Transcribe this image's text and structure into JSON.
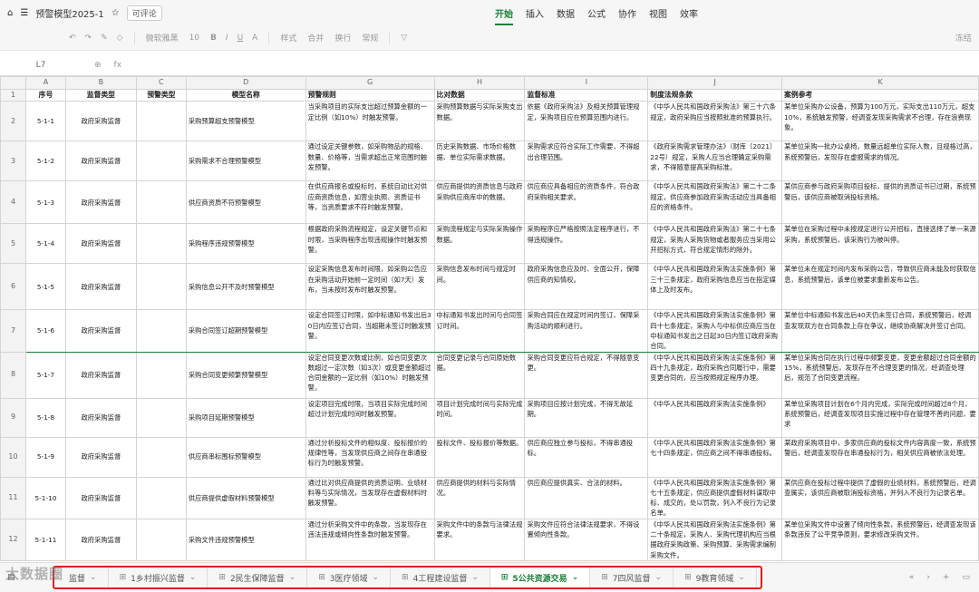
{
  "app": {
    "title": "预警模型2025-1",
    "badge": "可评论",
    "home_icon": "home-icon",
    "menu_icon": "menu-icon",
    "star_icon": "star-icon"
  },
  "menus": [
    "开始",
    "插入",
    "数据",
    "公式",
    "协作",
    "视图",
    "效率"
  ],
  "ribbon": {
    "font": "微软雅黑",
    "size": "10",
    "style": "样式",
    "merge": "合并",
    "wrap": "换行",
    "format": "常规",
    "freeze": "冻结"
  },
  "formula_bar": {
    "cell_ref": "L7",
    "fx": "fx"
  },
  "columns": [
    "A",
    "B",
    "C",
    "D",
    "G",
    "H",
    "I",
    "J",
    "K"
  ],
  "header": [
    "序号",
    "监督类型",
    "预警类型",
    "模型名称",
    "预警规则",
    "比对数据",
    "监督标准",
    "制度法规条款",
    "案例参考"
  ],
  "rows": [
    {
      "num": "2",
      "cells": [
        "5-1-1",
        "政府采购监督",
        "",
        "采购预算超支预警模型",
        "当采购项目的实际支出超过预算金额的一定比例（如10%）时触发预警。",
        "采购预算数据与实际采购支出数据。",
        "依据《政府采购法》及相关预算管理规定，采购项目应在预算范围内进行。",
        "《中华人民共和国政府采购法》第三十六条规定，政府采购应当按照批准的预算执行。",
        "某单位采购办公设备，预算为100万元，实际支出110万元，超支10%，系统触发预警，经调查发现采购需求不合理，存在浪费现象。"
      ]
    },
    {
      "num": "3",
      "cells": [
        "5-1-2",
        "政府采购监督",
        "",
        "采购需求不合理预警模型",
        "通过设定关键参数，如采购物品的规格、数量、价格等，当需求超出正常范围时触发预警。",
        "历史采购数据、市场价格数据、单位实际需求数据。",
        "采购需求应符合实际工作需要，不得超出合理范围。",
        "《政府采购需求管理办法》（财库〔2021〕22号）规定，采购人应当合理确定采购需求，不得随意提高采购标准。",
        "某单位采购一批办公桌椅，数量远超单位实际人数，且规格过高，系统预警后，发现存在虚报需求的情况。"
      ]
    },
    {
      "num": "4",
      "cells": [
        "5-1-3",
        "政府采购监督",
        "",
        "供应商资质不符预警模型",
        "在供应商报名或投标时，系统自动比对供应商资质信息，如营业执照、资质证书等，当资质要求不符时触发预警。",
        "供应商提供的资质信息与政府采购供应商库中的数据。",
        "供应商应具备相应的资质条件，符合政府采购相关要求。",
        "《中华人民共和国政府采购法》第二十二条规定，供应商参加政府采购活动应当具备相应的资格条件。",
        "某供应商参与政府采购项目投标，提供的资质证书已过期，系统预警后，该供应商被取消投标资格。"
      ]
    },
    {
      "num": "5",
      "cells": [
        "5-1-4",
        "政府采购监督",
        "",
        "采购程序违规预警模型",
        "根据政府采购流程规定，设定关键节点和时限，当采购程序出现违规操作时触发预警。",
        "采购流程规定与实际采购操作数据。",
        "采购程序应严格按照法定程序进行，不得违规操作。",
        "《中华人民共和国政府采购法》第二十七条规定，采购人采购货物或者服务应当采用公开招标方式，符合规定情形的除外。",
        "某单位在采购过程中未按规定进行公开招标，直接选择了单一来源采购，系统预警后，该采购行为被叫停。"
      ]
    },
    {
      "num": "6",
      "cells": [
        "5-1-5",
        "政府采购监督",
        "",
        "采购信息公开不及时预警模型",
        "设定采购信息发布时间限，如采购公告应在采购活动开始前一定时间（如7天）发布，当未按时发布时触发预警。",
        "采购信息发布时间与规定时间。",
        "政府采购信息应及时、全面公开，保障供应商的知情权。",
        "《中华人民共和国政府采购法实施条例》第三十三条规定，政府采购信息应当在指定媒体上及时发布。",
        "某单位未在规定时间内发布采购公告，导致供应商未能及时获取信息，系统预警后，该单位被要求重新发布公告。"
      ]
    },
    {
      "num": "7",
      "sel": true,
      "cells": [
        "5-1-6",
        "政府采购监督",
        "",
        "采购合同签订超期预警模型",
        "设定合同签订时限，如中标通知书发出后30日内应签订合同，当超期未签订时触发预警。",
        "中标通知书发出时间与合同签订时间。",
        "采购合同应在规定时间内签订，保障采购活动的顺利进行。",
        "《中华人民共和国政府采购法实施条例》第四十七条规定，采购人与中标供应商应当在中标通知书发出之日起30日内签订政府采购合同。",
        "某单位中标通知书发出后40天仍未签订合同，系统预警后，经调查发现双方在合同条款上存在争议，继续协商解决并签订合同。"
      ]
    },
    {
      "num": "8",
      "cells": [
        "5-1-7",
        "政府采购监督",
        "",
        "采购合同变更频繁预警模型",
        "设定合同变更次数或比例，如合同变更次数超过一定次数（如3次）或变更金额超过合同金额的一定比例（如10%）时触发预警。",
        "合同变更记录与合同原始数据。",
        "采购合同变更应符合规定，不得随意变更。",
        "《中华人民共和国政府采购法实施条例》第四十九条规定，政府采购合同履行中，需要变更合同的，应当按照规定程序办理。",
        "某单位采购合同在执行过程中频繁变更，变更金额超过合同金额的15%，系统预警后，发现存在不合理变更的情况，经调查处理后，规范了合同变更流程。"
      ]
    },
    {
      "num": "9",
      "cells": [
        "5-1-8",
        "政府采购监督",
        "",
        "采购项目延期预警模型",
        "设定项目完成时限，当项目实际完成时间超过计划完成时间时触发预警。",
        "项目计划完成时间与实际完成时间。",
        "采购项目应按计划完成，不得无故延期。",
        "《中华人民共和国政府采购法实施条例》",
        "某单位采购项目计划在6个月内完成，实际完成时间超过8个月，系统预警后，经调查发现项目实施过程中存在管理不善的问题，要求"
      ]
    },
    {
      "num": "10",
      "cells": [
        "5-1-9",
        "政府采购监督",
        "",
        "供应商串标围标预警模型",
        "通过分析投标文件的相似度、投标报价的规律性等，当发现供应商之间存在串通投标行为时触发预警。",
        "投标文件、投标报价等数据。",
        "供应商应独立参与投标，不得串通投标。",
        "《中华人民共和国政府采购法实施条例》第七十四条规定，供应商之间不得串通投标。",
        "某政府采购项目中，多家供应商的投标文件内容高度一致，系统预警后，经调查发现存在串通投标行为，相关供应商被依法处理。"
      ]
    },
    {
      "num": "11",
      "cells": [
        "5-1-10",
        "政府采购监督",
        "",
        "供应商提供虚假材料预警模型",
        "通过比对供应商提供的资质证明、业绩材料等与实际情况，当发现存在虚假材料时触发预警。",
        "供应商提供的材料与实际情况。",
        "供应商应提供真实、合法的材料。",
        "《中华人民共和国政府采购法实施条例》第七十五条规定，供应商提供虚假材料谋取中标、成交的，处以罚款，列入不良行为记录名单。",
        "某供应商在投标过程中提供了虚假的业绩材料，系统预警后，经调查属实，该供应商被取消投标资格，并列入不良行为记录名单。"
      ]
    },
    {
      "num": "12",
      "cells": [
        "5-1-11",
        "政府采购监督",
        "",
        "采购文件违规预警模型",
        "通过分析采购文件中的条款，当发现存在违法违规或倾向性条款时触发预警。",
        "采购文件中的条款与法律法规要求。",
        "采购文件应符合法律法规要求，不得设置倾向性条款。",
        "《中华人民共和国政府采购法实施条例》第二十条规定，采购人、采购代理机构应当根据政府采购政策、采购预算、采购需求编制采购文件。",
        "某单位采购文件中设置了倾向性条款，系统预警后，经调查发现该条款违反了公平竞争原则，要求修改采购文件。"
      ]
    }
  ],
  "sheet_tabs": [
    {
      "label": "1乡村振兴监督",
      "active": false
    },
    {
      "label": "2民生保障监督",
      "active": false
    },
    {
      "label": "3医疗领域",
      "active": false
    },
    {
      "label": "4工程建设监督",
      "active": false
    },
    {
      "label": "5公共资源交易",
      "active": true
    },
    {
      "label": "7四风监督",
      "active": false
    },
    {
      "label": "9教育领域",
      "active": false
    }
  ],
  "partial_tab": "监督",
  "watermark": "大数据圈",
  "colors": {
    "accent": "#1a7f37",
    "highlight_border": "#e02020"
  }
}
